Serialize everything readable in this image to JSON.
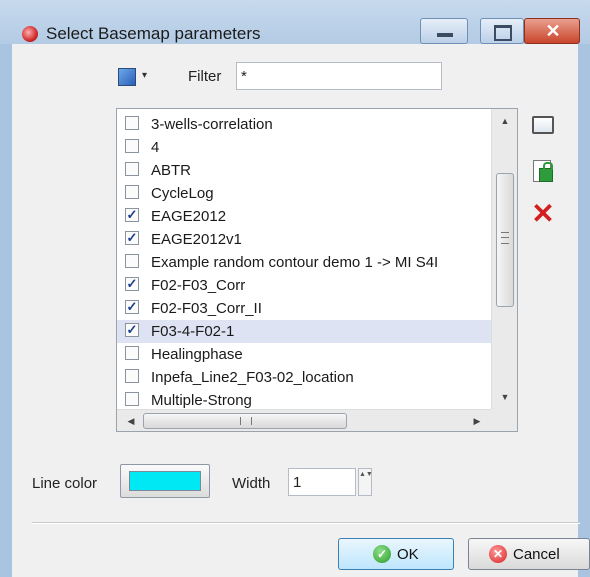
{
  "window": {
    "title": "Select Basemap parameters",
    "title_icon": "app-icon",
    "controls": {
      "minimize_icon": "minimize-icon",
      "maximize_icon": "maximize-icon",
      "close_icon": "close-icon",
      "close_glyph": "✕"
    }
  },
  "toolbar": {
    "color_icon": "color-square-icon",
    "dropdown_glyph": "▾",
    "filter_label": "Filter",
    "filter_value": "*"
  },
  "list": {
    "items": [
      {
        "label": "3-wells-correlation",
        "checked": false,
        "check": ""
      },
      {
        "label": "4",
        "checked": false,
        "check": ""
      },
      {
        "label": "ABTR",
        "checked": false,
        "check": ""
      },
      {
        "label": "CycleLog",
        "checked": false,
        "check": ""
      },
      {
        "label": "EAGE2012",
        "checked": true,
        "check": "✓"
      },
      {
        "label": "EAGE2012v1",
        "checked": true,
        "check": "✓"
      },
      {
        "label": "Example random contour demo 1 -> MI S4I",
        "checked": false,
        "check": ""
      },
      {
        "label": "F02-F03_Corr",
        "checked": true,
        "check": "✓"
      },
      {
        "label": "F02-F03_Corr_II",
        "checked": true,
        "check": "✓"
      },
      {
        "label": "F03-4-F02-1",
        "checked": true,
        "check": "✓",
        "selected": true
      },
      {
        "label": "Healingphase",
        "checked": false,
        "check": ""
      },
      {
        "label": "Inpefa_Line2_F03-02_location",
        "checked": false,
        "check": ""
      },
      {
        "label": "Multiple-Strong",
        "checked": false,
        "check": ""
      }
    ],
    "scroll_up": "▲",
    "scroll_down": "▼",
    "scroll_left": "◀",
    "scroll_right": "▶"
  },
  "side_buttons": {
    "new_icon": "blank-document-icon",
    "save_icon": "save-icon",
    "delete_icon": "delete-icon",
    "delete_glyph": "✕"
  },
  "line": {
    "color_label": "Line color",
    "color": "#00e8f4",
    "width_label": "Width",
    "width_value": "1",
    "spin_glyph": "▲▼"
  },
  "buttons": {
    "ok_label": "OK",
    "ok_glyph": "✓",
    "cancel_label": "Cancel",
    "cancel_glyph": "✕"
  }
}
